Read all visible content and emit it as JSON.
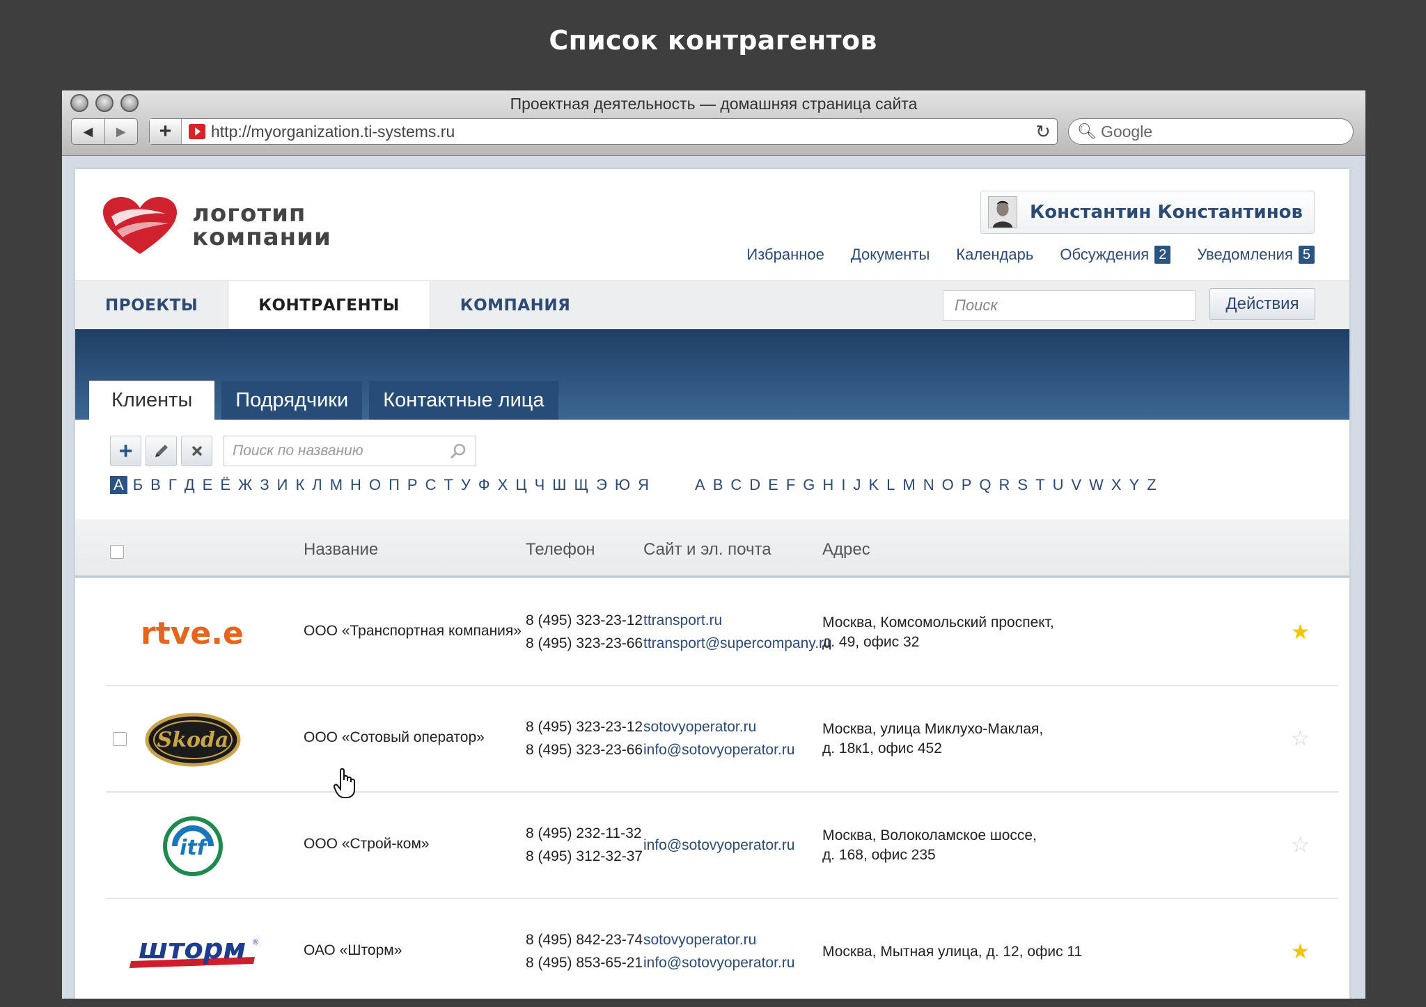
{
  "slide_title": "Список контрагентов",
  "browser": {
    "window_title": "Проектная деятельность — домашняя страница сайта",
    "url": "http://myorganization.ti-systems.ru",
    "search_placeholder": "Google"
  },
  "header": {
    "logo_line1": "логотип",
    "logo_line2": "компании",
    "user_name": "Константин Константинов",
    "links": [
      {
        "label": "Избранное"
      },
      {
        "label": "Документы"
      },
      {
        "label": "Календарь"
      },
      {
        "label": "Обсуждения",
        "badge": "2"
      },
      {
        "label": "Уведомления",
        "badge": "5"
      }
    ]
  },
  "mainnav": {
    "items": [
      "ПРОЕКТЫ",
      "КОНТРАГЕНТЫ",
      "КОМПАНИЯ"
    ],
    "active_index": 1,
    "search_placeholder": "Поиск",
    "actions_label": "Действия"
  },
  "subtabs": {
    "items": [
      "Клиенты",
      "Подрядчики",
      "Контактные лица"
    ],
    "active_index": 0
  },
  "toolbar": {
    "name_search_placeholder": "Поиск по названию"
  },
  "alphabet": {
    "cyrillic": [
      "А",
      "Б",
      "В",
      "Г",
      "Д",
      "Е",
      "Ё",
      "Ж",
      "З",
      "И",
      "К",
      "Л",
      "М",
      "Н",
      "О",
      "П",
      "Р",
      "С",
      "Т",
      "У",
      "Ф",
      "Х",
      "Ц",
      "Ч",
      "Ш",
      "Щ",
      "Э",
      "Ю",
      "Я"
    ],
    "latin": [
      "A",
      "B",
      "C",
      "D",
      "E",
      "F",
      "G",
      "H",
      "I",
      "J",
      "K",
      "L",
      "M",
      "N",
      "O",
      "P",
      "Q",
      "R",
      "S",
      "T",
      "U",
      "V",
      "W",
      "X",
      "Y",
      "Z"
    ],
    "selected": "А"
  },
  "table": {
    "columns": [
      "Название",
      "Телефон",
      "Сайт и эл. почта",
      "Адрес"
    ],
    "rows": [
      {
        "logo": "rtve-logo",
        "logo_text": "rtve.es",
        "name": "ООО «Транспортная компания»",
        "phones": [
          "8 (495) 323-23-12",
          "8 (495) 323-23-66"
        ],
        "contacts": [
          "ttransport.ru",
          "ttransport@supercompany.ru"
        ],
        "address": [
          "Москва, Комсомольский проспект,",
          "д. 49, офис 32"
        ],
        "favorite": true,
        "show_checkbox": false
      },
      {
        "logo": "skoda-logo",
        "logo_text": "Skoda",
        "name": "ООО «Сотовый оператор»",
        "phones": [
          "8 (495) 323-23-12",
          "8 (495) 323-23-66"
        ],
        "contacts": [
          "sotovyoperator.ru",
          "info@sotovyoperator.ru"
        ],
        "address": [
          "Москва, улица Миклухо-Маклая,",
          "д. 18к1, офис 452"
        ],
        "favorite": false,
        "show_checkbox": true
      },
      {
        "logo": "itf-logo",
        "logo_text": "itf",
        "name": "ООО «Строй-ком»",
        "phones": [
          "8 (495) 232-11-32",
          "8 (495) 312-32-37"
        ],
        "contacts": [
          "info@sotovyoperator.ru"
        ],
        "address": [
          "Москва, Волоколамское шоссе,",
          "д. 168, офис 235"
        ],
        "favorite": false,
        "show_checkbox": false
      },
      {
        "logo": "shtorm-logo",
        "logo_text": "шторм",
        "name": "ОАО «Шторм»",
        "phones": [
          "8 (495) 842-23-74",
          "8 (495) 853-65-21"
        ],
        "contacts": [
          "sotovyoperator.ru",
          "info@sotovyoperator.ru"
        ],
        "address": [
          "Москва, Мытная улица, д. 12, офис 11"
        ],
        "favorite": true,
        "show_checkbox": false
      }
    ]
  },
  "colors": {
    "accent": "#2c4a73",
    "band": "#264c77",
    "star": "#f5c400",
    "backdrop": "#3e3e3e"
  }
}
